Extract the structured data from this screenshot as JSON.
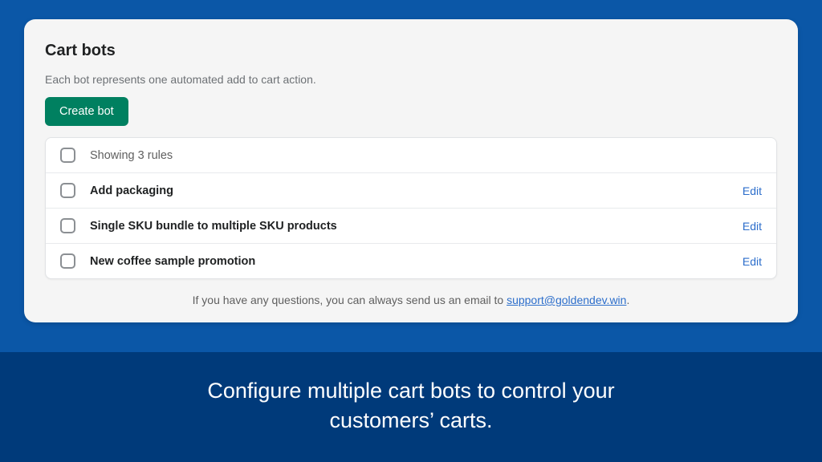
{
  "card": {
    "title": "Cart bots",
    "description": "Each bot represents one automated add to cart action.",
    "create_label": "Create bot"
  },
  "list": {
    "header_label": "Showing 3 rules",
    "edit_label": "Edit",
    "rows": [
      {
        "label": "Add packaging"
      },
      {
        "label": "Single SKU bundle to multiple SKU products"
      },
      {
        "label": "New coffee sample promotion"
      }
    ]
  },
  "support": {
    "prefix": "If you have any questions, you can always send us an email to ",
    "email": "support@goldendev.win",
    "suffix": "."
  },
  "banner": {
    "line1": "Configure multiple cart bots to control your",
    "line2": "customers’ carts."
  }
}
